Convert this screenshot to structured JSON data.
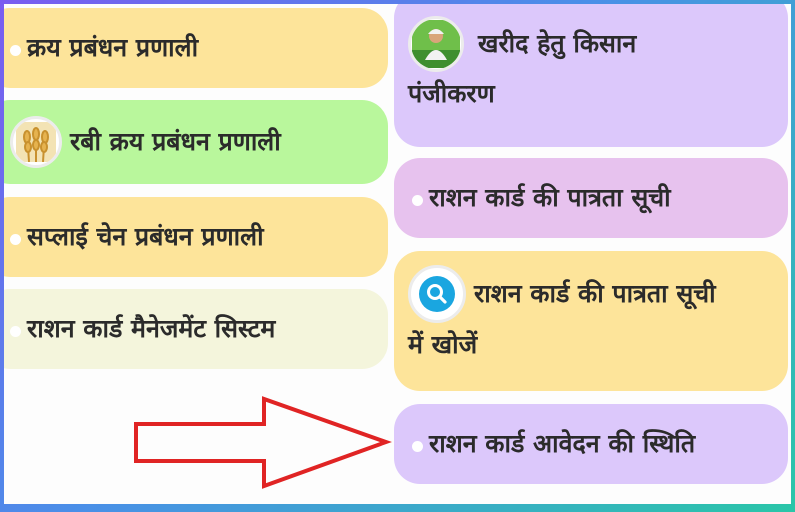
{
  "left_column": [
    {
      "label": "क्रय प्रबंधन प्रणाली",
      "color": "#fde49a"
    },
    {
      "label": "रबी क्रय प्रबंधन प्रणाली",
      "color": "#b9f79c",
      "icon": "wheat-icon"
    },
    {
      "label": "सप्लाई चेन प्रबंधन प्रणाली",
      "color": "#fde49a"
    },
    {
      "label": "राशन कार्ड मैनेजमेंट सिस्टम",
      "color": "#f4f5dc"
    }
  ],
  "right_column": [
    {
      "label_line1": "खरीद हेतु किसान",
      "label_line2": "पंजीकरण",
      "color": "#dcc8fb",
      "icon": "farmer-icon"
    },
    {
      "label": "राशन कार्ड की पात्रता सूची",
      "color": "#e7c2ee"
    },
    {
      "label_line1": "राशन कार्ड की पात्रता सूची",
      "label_line2": "में खोजें",
      "color": "#fde49a",
      "icon": "search-icon"
    },
    {
      "label": "राशन कार्ड आवेदन की स्थिति",
      "color": "#dcc8fb"
    }
  ],
  "annotation": {
    "arrow_color": "#e02424",
    "icon": "arrow-right-icon"
  }
}
